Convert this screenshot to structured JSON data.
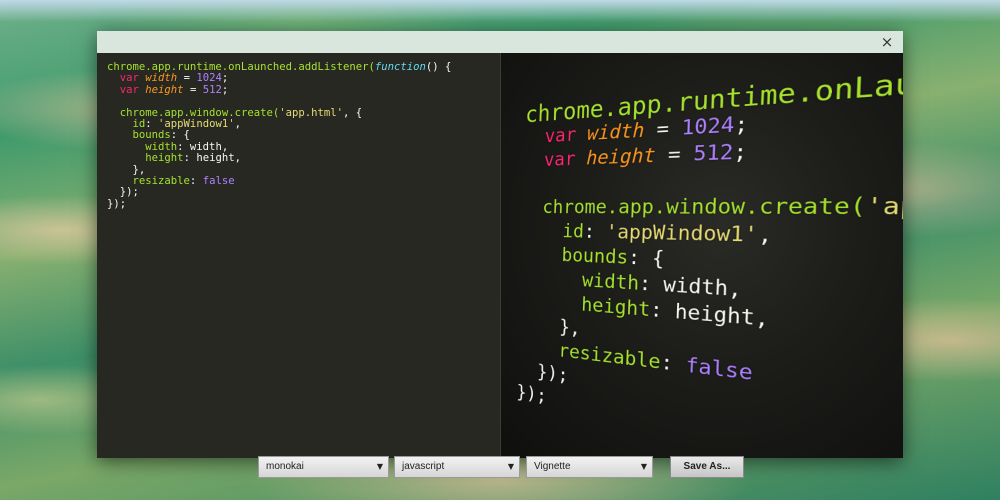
{
  "window": {
    "close_glyph": "×"
  },
  "editor": {
    "lines": [
      [
        [
          "p",
          "chrome.app.runtime.onLaunched.addListener("
        ],
        [
          "f",
          "function"
        ],
        [
          "w",
          "() {"
        ]
      ],
      [
        [
          "w",
          "  "
        ],
        [
          "k",
          "var"
        ],
        [
          "w",
          " "
        ],
        [
          "v",
          "width"
        ],
        [
          "w",
          " = "
        ],
        [
          "n",
          "1024"
        ],
        [
          "w",
          ";"
        ]
      ],
      [
        [
          "w",
          "  "
        ],
        [
          "k",
          "var"
        ],
        [
          "w",
          " "
        ],
        [
          "v",
          "height"
        ],
        [
          "w",
          " = "
        ],
        [
          "n",
          "512"
        ],
        [
          "w",
          ";"
        ]
      ],
      [
        [
          "w",
          ""
        ]
      ],
      [
        [
          "w",
          "  "
        ],
        [
          "p",
          "chrome.app.window.create("
        ],
        [
          "s",
          "'app.html'"
        ],
        [
          "w",
          ", {"
        ]
      ],
      [
        [
          "w",
          "    "
        ],
        [
          "c",
          "id"
        ],
        [
          "w",
          ": "
        ],
        [
          "s",
          "'appWindow1'"
        ],
        [
          "w",
          ","
        ]
      ],
      [
        [
          "w",
          "    "
        ],
        [
          "c",
          "bounds"
        ],
        [
          "w",
          ": {"
        ]
      ],
      [
        [
          "w",
          "      "
        ],
        [
          "c",
          "width"
        ],
        [
          "w",
          ": width,"
        ]
      ],
      [
        [
          "w",
          "      "
        ],
        [
          "c",
          "height"
        ],
        [
          "w",
          ": height,"
        ]
      ],
      [
        [
          "w",
          "    },"
        ]
      ],
      [
        [
          "w",
          "    "
        ],
        [
          "c",
          "resizable"
        ],
        [
          "w",
          ": "
        ],
        [
          "n",
          "false"
        ]
      ],
      [
        [
          "w",
          "  });"
        ]
      ],
      [
        [
          "w",
          "});"
        ]
      ]
    ]
  },
  "preview": {
    "lines": [
      [
        [
          "p",
          "chrome.app.runtime.onLaunched.addL"
        ]
      ],
      [
        [
          "w",
          "  "
        ],
        [
          "k",
          "var"
        ],
        [
          "w",
          " "
        ],
        [
          "v",
          "width"
        ],
        [
          "w",
          " = "
        ],
        [
          "n",
          "1024"
        ],
        [
          "w",
          ";"
        ]
      ],
      [
        [
          "w",
          "  "
        ],
        [
          "k",
          "var"
        ],
        [
          "w",
          " "
        ],
        [
          "v",
          "height"
        ],
        [
          "w",
          " = "
        ],
        [
          "n",
          "512"
        ],
        [
          "w",
          ";"
        ]
      ],
      [
        [
          "w",
          ""
        ]
      ],
      [
        [
          "w",
          "  "
        ],
        [
          "p",
          "chrome.app.window.create("
        ],
        [
          "s",
          "'app.htm"
        ]
      ],
      [
        [
          "w",
          "    "
        ],
        [
          "c",
          "id"
        ],
        [
          "w",
          ": "
        ],
        [
          "s",
          "'appWindow1'"
        ],
        [
          "w",
          ","
        ]
      ],
      [
        [
          "w",
          "    "
        ],
        [
          "c",
          "bounds"
        ],
        [
          "w",
          ": {"
        ]
      ],
      [
        [
          "w",
          "      "
        ],
        [
          "c",
          "width"
        ],
        [
          "w",
          ": width,"
        ]
      ],
      [
        [
          "w",
          "      "
        ],
        [
          "c",
          "height"
        ],
        [
          "w",
          ": height,"
        ]
      ],
      [
        [
          "w",
          "    },"
        ]
      ],
      [
        [
          "w",
          "    "
        ],
        [
          "c",
          "resizable"
        ],
        [
          "w",
          ": "
        ],
        [
          "n",
          "false"
        ]
      ],
      [
        [
          "w",
          "  });"
        ]
      ],
      [
        [
          "w",
          "});"
        ]
      ]
    ]
  },
  "controls": {
    "theme": {
      "selected": "monokai",
      "arrow": "▼"
    },
    "language": {
      "selected": "javascript",
      "arrow": "▼"
    },
    "effect": {
      "selected": "Vignette",
      "arrow": "▼"
    },
    "save_label": "Save As..."
  },
  "colors": {
    "keyword": "#f92672",
    "property": "#a6e22e",
    "function": "#66d9ef",
    "number": "#ae81ff",
    "string": "#e6db74",
    "editor_bg": "#272822"
  }
}
